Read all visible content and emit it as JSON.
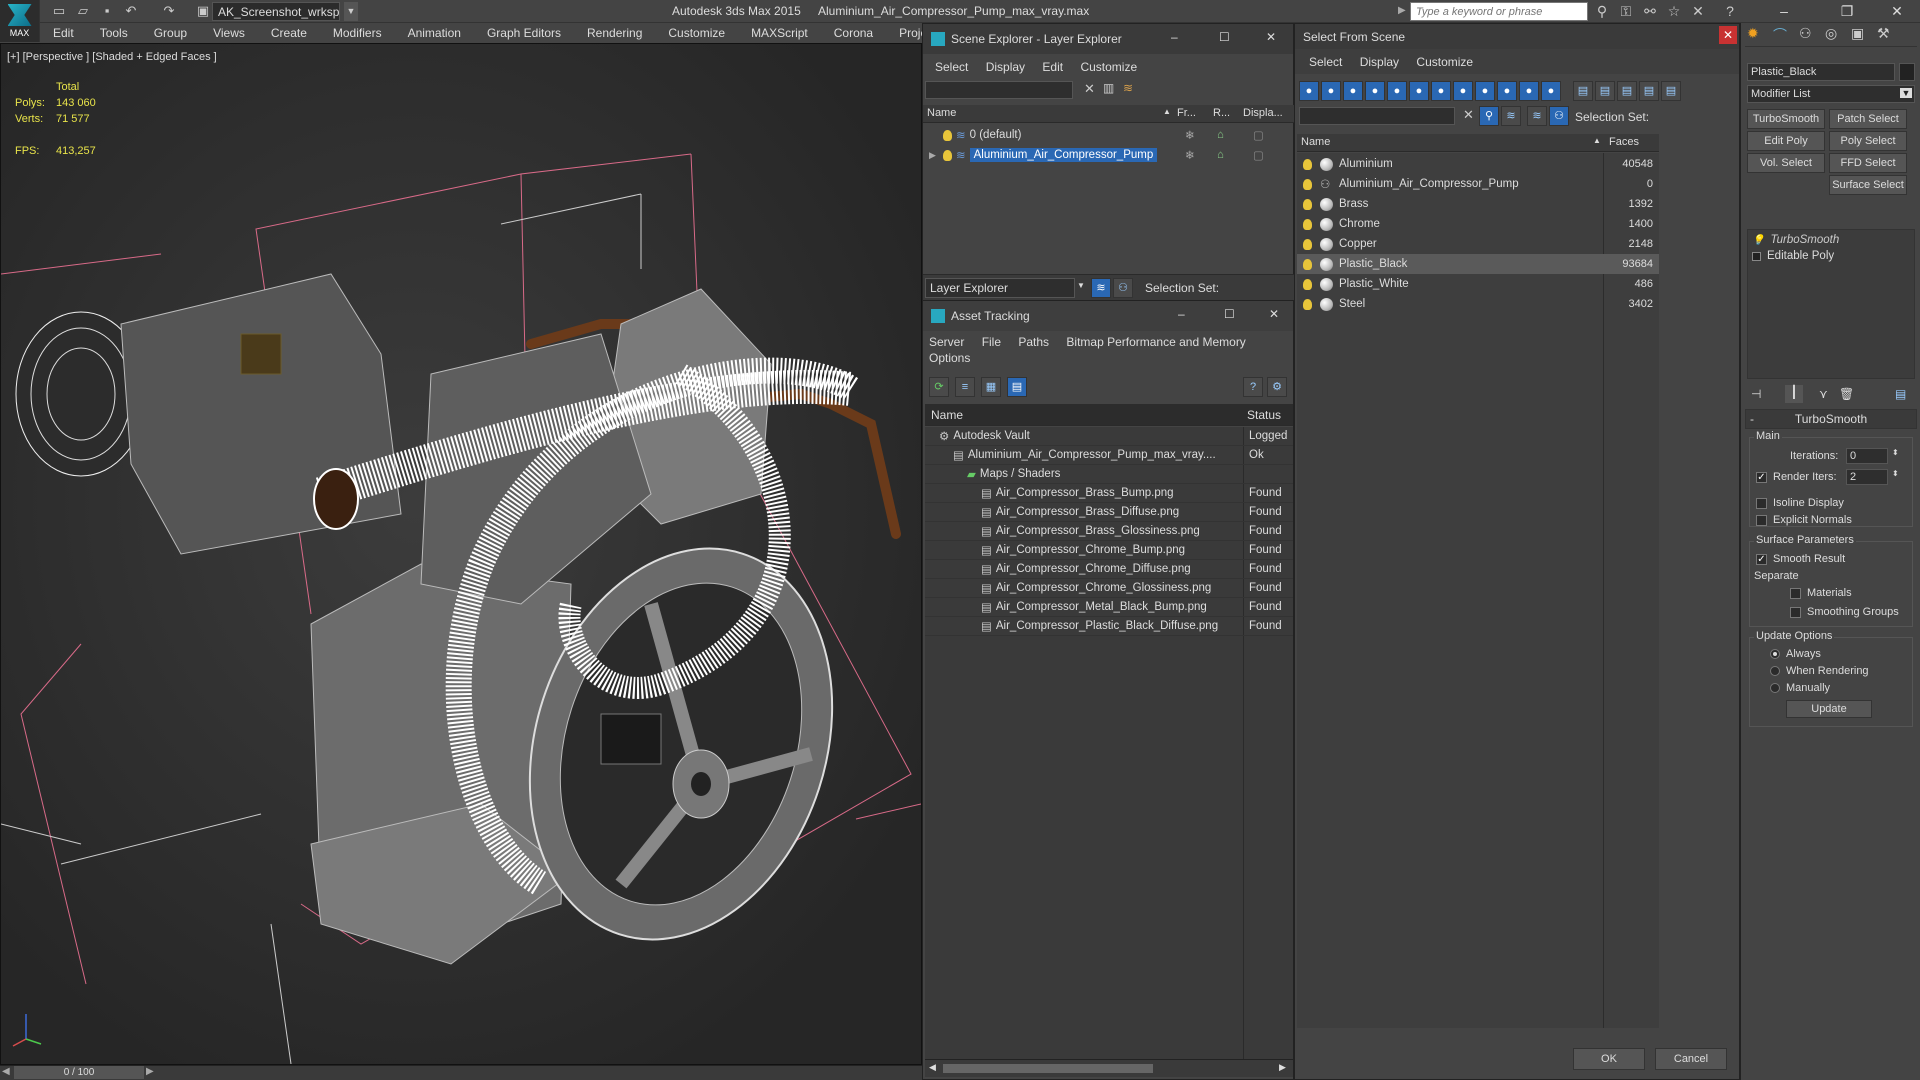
{
  "titlebar": {
    "logo_text": "MAX",
    "workspace": "AK_Screenshot_wrksp",
    "app_name": "Autodesk 3ds Max  2015",
    "file_name": "Aluminium_Air_Compressor_Pump_max_vray.max",
    "search_placeholder": "Type a keyword or phrase"
  },
  "menu": [
    "Edit",
    "Tools",
    "Group",
    "Views",
    "Create",
    "Modifiers",
    "Animation",
    "Graph Editors",
    "Rendering",
    "Customize",
    "MAXScript",
    "Corona",
    "Project Man"
  ],
  "viewport": {
    "label": "[+] [Perspective ] [Shaded + Edged Faces ]",
    "total_label": "Total",
    "polys_label": "Polys:",
    "polys_value": "143 060",
    "verts_label": "Verts:",
    "verts_value": "71 577",
    "fps_label": "FPS:",
    "fps_value": "413,257"
  },
  "timeline": {
    "frame": "0 / 100"
  },
  "scene_explorer": {
    "title": "Scene Explorer - Layer Explorer",
    "menu": [
      "Select",
      "Display",
      "Edit",
      "Customize"
    ],
    "columns": {
      "name": "Name",
      "frozen": "Fr...",
      "render": "R...",
      "display": "Displa..."
    },
    "rows": [
      {
        "name": "0 (default)",
        "selected": false
      },
      {
        "name": "Aluminium_Air_Compressor_Pump",
        "selected": true
      }
    ],
    "footer_dropdown": "Layer Explorer",
    "footer_selection_label": "Selection Set:"
  },
  "asset_tracking": {
    "title": "Asset Tracking",
    "menu": [
      "Server",
      "File",
      "Paths",
      "Bitmap Performance and Memory"
    ],
    "menu2": [
      "Options"
    ],
    "columns": {
      "name": "Name",
      "status": "Status"
    },
    "rows": [
      {
        "name": "Autodesk Vault",
        "status": "Logged",
        "indent": 1
      },
      {
        "name": "Aluminium_Air_Compressor_Pump_max_vray....",
        "status": "Ok",
        "indent": 2
      },
      {
        "name": "Maps / Shaders",
        "status": "",
        "indent": 3
      },
      {
        "name": "Air_Compressor_Brass_Bump.png",
        "status": "Found",
        "indent": 4
      },
      {
        "name": "Air_Compressor_Brass_Diffuse.png",
        "status": "Found",
        "indent": 4
      },
      {
        "name": "Air_Compressor_Brass_Glossiness.png",
        "status": "Found",
        "indent": 4
      },
      {
        "name": "Air_Compressor_Chrome_Bump.png",
        "status": "Found",
        "indent": 4
      },
      {
        "name": "Air_Compressor_Chrome_Diffuse.png",
        "status": "Found",
        "indent": 4
      },
      {
        "name": "Air_Compressor_Chrome_Glossiness.png",
        "status": "Found",
        "indent": 4
      },
      {
        "name": "Air_Compressor_Metal_Black_Bump.png",
        "status": "Found",
        "indent": 4
      },
      {
        "name": "Air_Compressor_Plastic_Black_Diffuse.png",
        "status": "Found",
        "indent": 4
      }
    ]
  },
  "select_from_scene": {
    "title": "Select From Scene",
    "menu": [
      "Select",
      "Display",
      "Customize"
    ],
    "selection_label": "Selection Set:",
    "columns": {
      "name": "Name",
      "faces": "Faces"
    },
    "rows": [
      {
        "name": "Aluminium",
        "faces": "40548",
        "selected": false,
        "icon": "material"
      },
      {
        "name": "Aluminium_Air_Compressor_Pump",
        "faces": "0",
        "selected": false,
        "icon": "group"
      },
      {
        "name": "Brass",
        "faces": "1392",
        "selected": false,
        "icon": "material"
      },
      {
        "name": "Chrome",
        "faces": "1400",
        "selected": false,
        "icon": "material"
      },
      {
        "name": "Copper",
        "faces": "2148",
        "selected": false,
        "icon": "material"
      },
      {
        "name": "Plastic_Black",
        "faces": "93684",
        "selected": true,
        "icon": "material"
      },
      {
        "name": "Plastic_White",
        "faces": "486",
        "selected": false,
        "icon": "material"
      },
      {
        "name": "Steel",
        "faces": "3402",
        "selected": false,
        "icon": "material"
      }
    ],
    "ok": "OK",
    "cancel": "Cancel"
  },
  "command_panel": {
    "object_name": "Plastic_Black",
    "modifier_list": "Modifier List",
    "buttons": [
      "TurboSmooth",
      "Patch Select",
      "Edit Poly",
      "Poly Select",
      "Vol. Select",
      "FFD Select",
      "Surface Select"
    ],
    "stack": [
      "TurboSmooth",
      "Editable Poly"
    ],
    "rollout_title": "TurboSmooth",
    "main_label": "Main",
    "iterations_label": "Iterations:",
    "iterations_value": "0",
    "render_iters_label": "Render Iters:",
    "render_iters_value": "2",
    "isoline_label": "Isoline Display",
    "explicit_normals_label": "Explicit Normals",
    "surface_params_label": "Surface Parameters",
    "smooth_result_label": "Smooth Result",
    "separate_label": "Separate",
    "materials_label": "Materials",
    "smoothing_groups_label": "Smoothing Groups",
    "update_options_label": "Update Options",
    "always_label": "Always",
    "when_rendering_label": "When Rendering",
    "manually_label": "Manually",
    "update_button": "Update"
  },
  "colors": {
    "panel_bg": "#444444",
    "selection_blue": "#2a68b4",
    "stat_yellow": "#e8e34a",
    "wire_white": "#ffffff",
    "copper": "#6a3a1a"
  }
}
